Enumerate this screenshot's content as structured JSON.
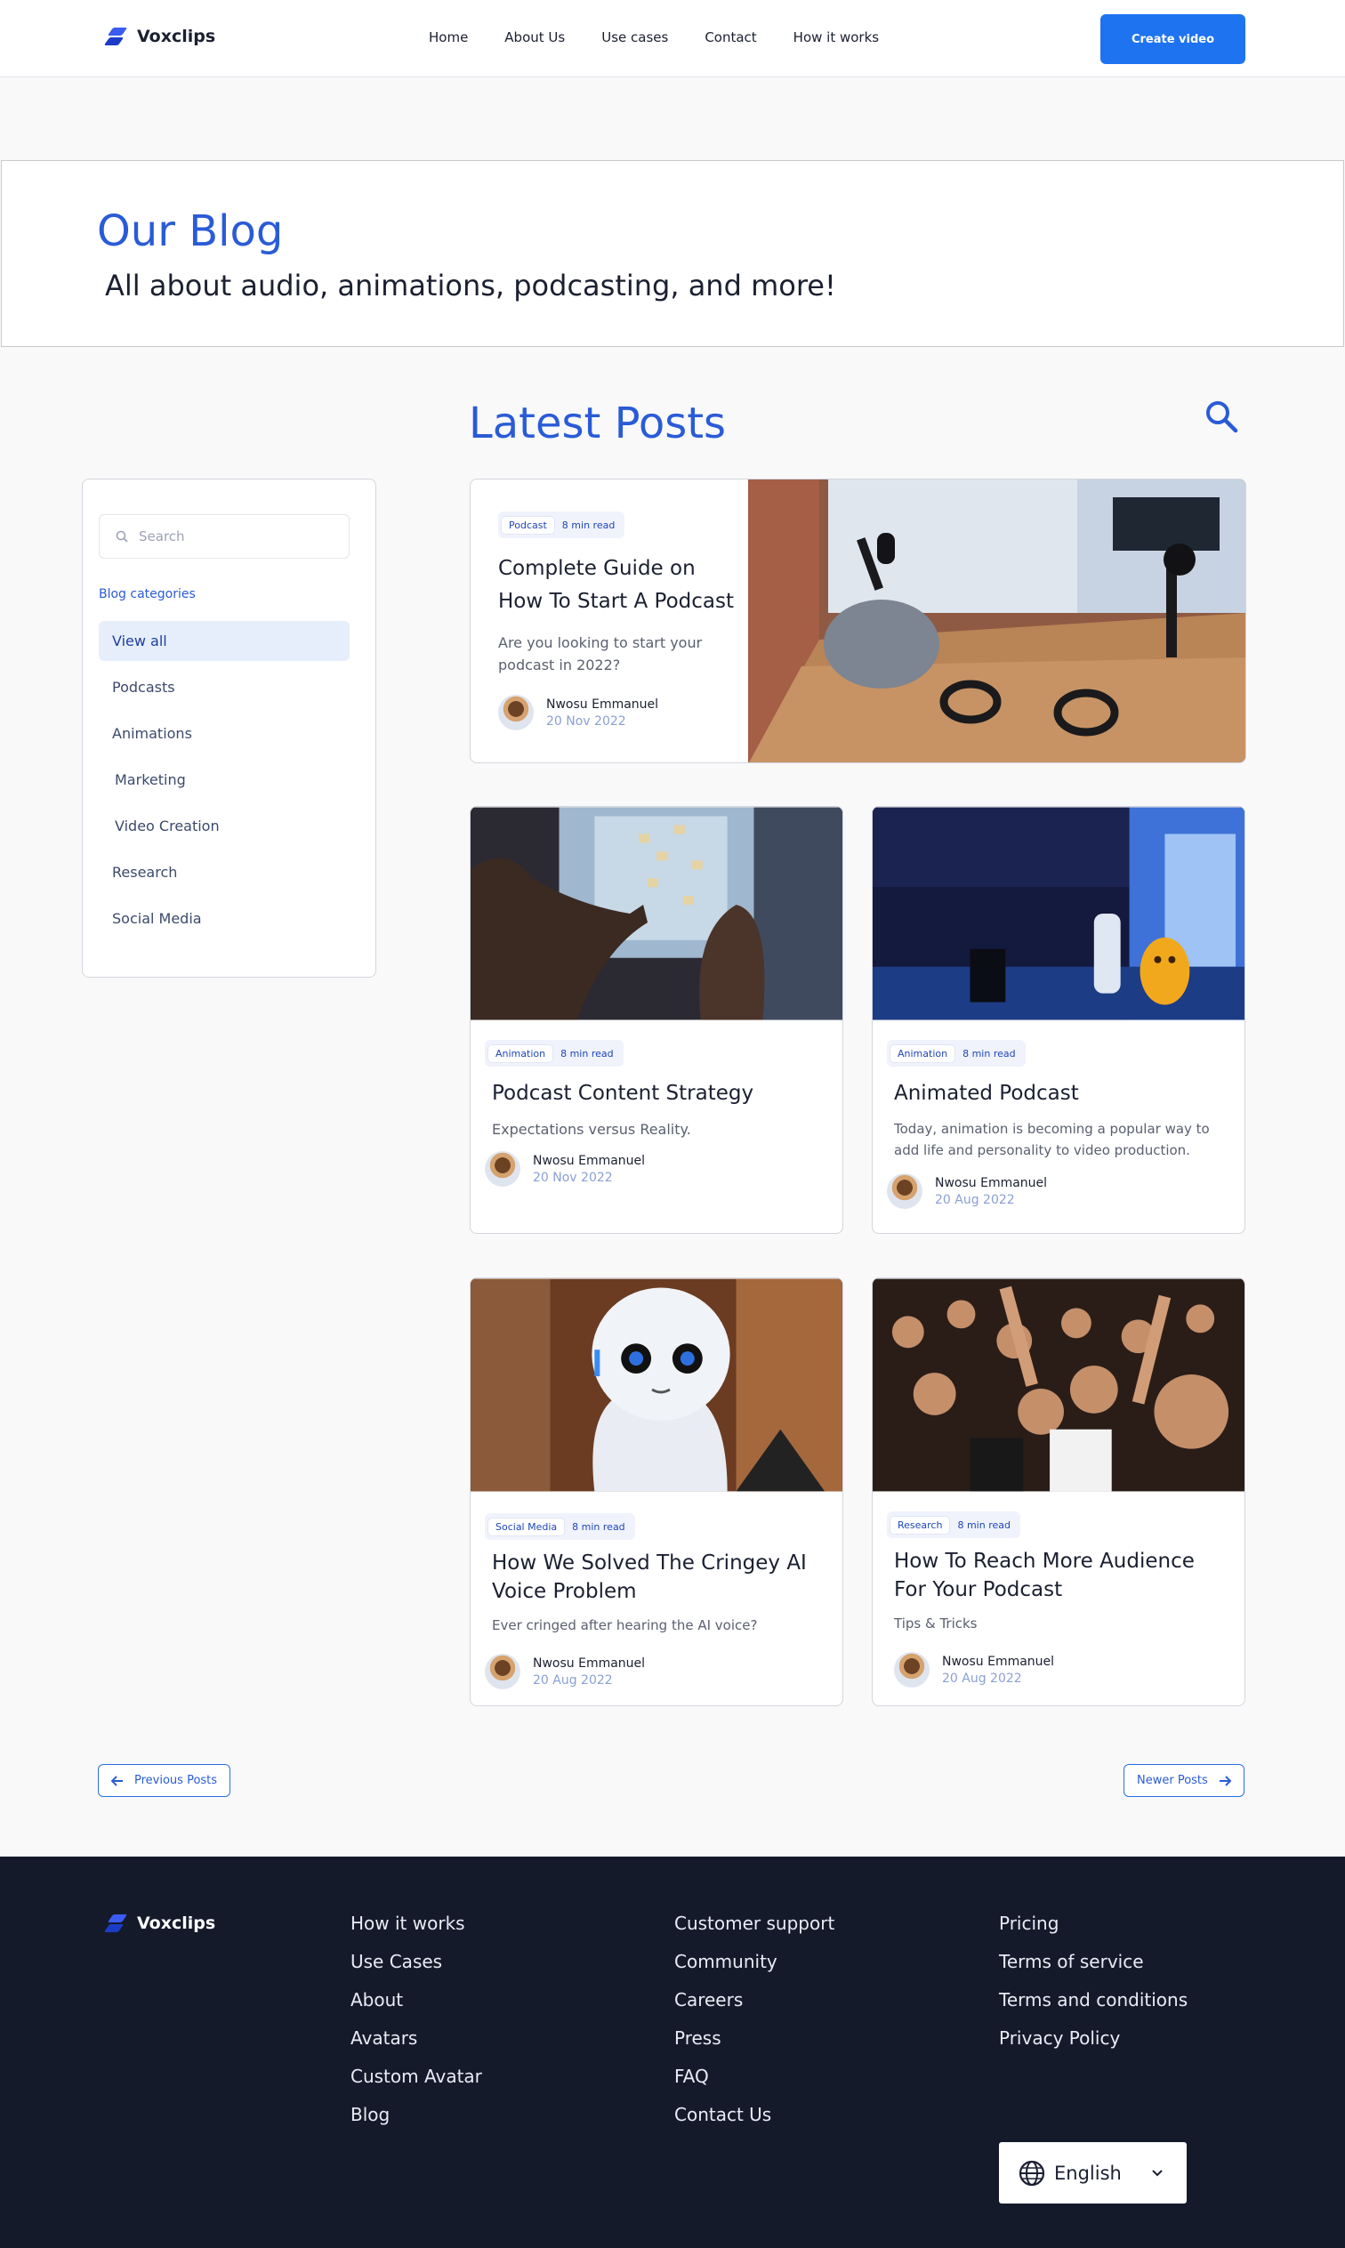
{
  "brand": {
    "name": "Voxclips"
  },
  "nav": {
    "items": [
      "Home",
      "About Us",
      "Use cases",
      "Contact",
      "How it works"
    ],
    "cta": "Create video"
  },
  "hero": {
    "title": "Our Blog",
    "subtitle": "All about audio, animations, podcasting, and more!"
  },
  "latest": {
    "title": "Latest Posts"
  },
  "sidebar": {
    "search_placeholder": "Search",
    "categories_title": "Blog categories",
    "categories": [
      "View all",
      "Podcasts",
      "Animations",
      "Marketing",
      "Video Creation",
      "Research",
      "Social Media"
    ]
  },
  "posts": [
    {
      "tag": "Podcast",
      "read": "8 min read",
      "title": "Complete Guide on How To Start A Podcast",
      "desc": "Are you looking to start your podcast in 2022?",
      "author": "Nwosu Emmanuel",
      "date": "20 Nov 2022"
    },
    {
      "tag": "Animation",
      "read": "8 min read",
      "title": "Podcast Content Strategy",
      "desc": "Expectations versus Reality.",
      "author": "Nwosu Emmanuel",
      "date": "20 Nov 2022"
    },
    {
      "tag": "Animation",
      "read": "8 min read",
      "title": "Animated Podcast",
      "desc": "Today, animation is becoming a popular way to add life and personality to video production.",
      "author": "Nwosu Emmanuel",
      "date": "20 Aug 2022"
    },
    {
      "tag": "Social Media",
      "read": "8 min read",
      "title": "How We Solved The Cringey AI Voice Problem",
      "desc": "Ever cringed after hearing the AI voice?",
      "author": "Nwosu Emmanuel",
      "date": "20 Aug 2022"
    },
    {
      "tag": "Research",
      "read": "8 min read",
      "title": "How To Reach More Audience For Your Podcast",
      "desc": "Tips & Tricks",
      "author": "Nwosu Emmanuel",
      "date": "20 Aug 2022"
    }
  ],
  "pager": {
    "prev": "Previous Posts",
    "next": "Newer Posts"
  },
  "footer": {
    "col1": [
      "How it works",
      "Use Cases",
      "About",
      "Avatars",
      "Custom Avatar",
      "Blog"
    ],
    "col2": [
      "Customer support",
      "Community",
      "Careers",
      "Press",
      "FAQ",
      "Contact Us"
    ],
    "col3": [
      "Pricing",
      "Terms of service",
      "Terms and conditions",
      "Privacy Policy"
    ],
    "language": "English"
  },
  "colors": {
    "accent": "#2a5bd7",
    "cta": "#1e73f0",
    "footer_bg": "#151a2b"
  }
}
